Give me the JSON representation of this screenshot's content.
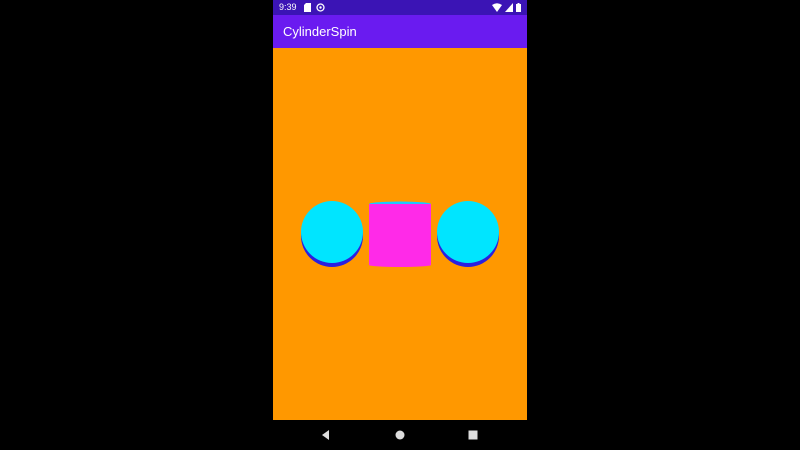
{
  "status_bar": {
    "time": "9:39",
    "left_icons": [
      "sd-card-icon",
      "sync-icon"
    ],
    "right_icons": [
      "wifi-icon",
      "signal-icon",
      "battery-icon"
    ]
  },
  "app_bar": {
    "title": "CylinderSpin"
  },
  "scene": {
    "background_color": "#ff9800",
    "objects": [
      {
        "name": "left-cylinder-end",
        "view": "end",
        "face_color": "#00e5ff",
        "side_color": "#2a1fe0"
      },
      {
        "name": "center-cylinder",
        "view": "side",
        "face_color": "#ff2ae8",
        "top_color": "#1ec8ff"
      },
      {
        "name": "right-cylinder-end",
        "view": "end",
        "face_color": "#00e5ff",
        "side_color": "#2a1fe0"
      }
    ]
  },
  "nav_bar": {
    "buttons": [
      "back-icon",
      "home-icon",
      "recents-icon"
    ]
  },
  "colors": {
    "status_bar": "#3b14b5",
    "app_bar": "#6a1bf0",
    "canvas": "#ff9800"
  }
}
